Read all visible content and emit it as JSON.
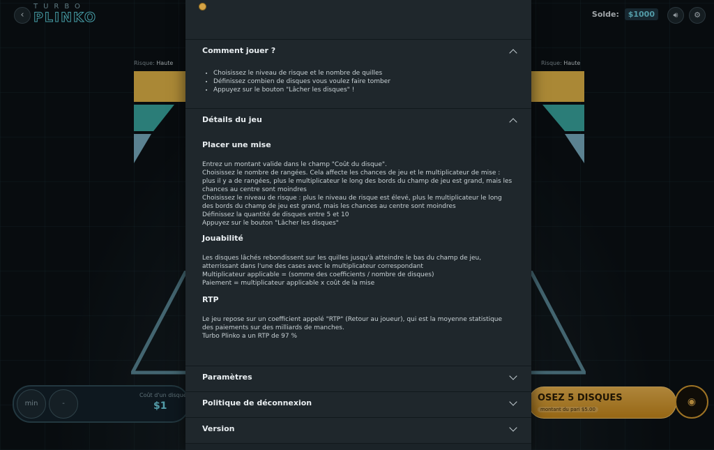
{
  "game": {
    "logo_top": "TURBO",
    "logo_main": "PLINKO",
    "balance_label": "Solde:",
    "balance_value": "$1000",
    "risk_label": "Risque:",
    "risk_value": "Haute",
    "min_label": "min",
    "minus_label": "-",
    "cost_label": "Coût d'un disque",
    "cost_value": "$1",
    "launch_label": "OSEZ 5 DISQUES",
    "launch_sub": "montant du pari $5.00"
  },
  "help": {
    "how_to_play": {
      "title": "Comment jouer ?",
      "items": [
        "Choisissez le niveau de risque et le nombre de quilles",
        "Définissez combien de disques vous voulez faire tomber",
        "Appuyez sur le bouton \"Lâcher les disques\" !"
      ]
    },
    "game_details": {
      "title": "Détails du jeu",
      "place_bet": {
        "title": "Placer une mise",
        "lines": [
          "Entrez un montant valide dans le champ \"Coût du disque\".",
          "Choisissez le nombre de rangées. Cela affecte les chances de jeu et le multiplicateur de mise : plus il y a de rangées, plus le multiplicateur le long des bords du champ de jeu est grand, mais les chances au centre sont moindres",
          "Choisissez le niveau de risque : plus le niveau de risque est élevé, plus le multiplicateur le long des bords du champ de jeu est grand, mais les chances au centre sont moindres",
          "Définissez la quantité de disques entre 5 et 10",
          "Appuyez sur le bouton \"Lâcher les disques\""
        ]
      },
      "gameplay": {
        "title": "Jouabilité",
        "lines": [
          "Les disques lâchés rebondissent sur les quilles jusqu'à atteindre le bas du champ de jeu, atterrissant dans l'une des cases avec le multiplicateur correspondant",
          "Multiplicateur applicable = (somme des coefficients / nombre de disques)",
          "Paiement = multiplicateur applicable x coût de la mise"
        ]
      },
      "rtp": {
        "title": "RTP",
        "lines": [
          "Le jeu repose sur un coefficient appelé \"RTP\" (Retour au joueur), qui est la moyenne statistique des paiements sur des milliards de manches.",
          "Turbo Plinko a un RTP de 97 %"
        ]
      }
    },
    "settings": {
      "title": "Paramètres"
    },
    "disconnect": {
      "title": "Politique de déconnexion"
    },
    "version": {
      "title": "Version"
    }
  },
  "colors": {
    "accent_cyan": "#6fd0e0",
    "risk_yellow": "#e3b649",
    "risk_green": "#3aa7a0",
    "risk_blue": "#7aaec2",
    "launch_orange": "#e9b24e"
  }
}
